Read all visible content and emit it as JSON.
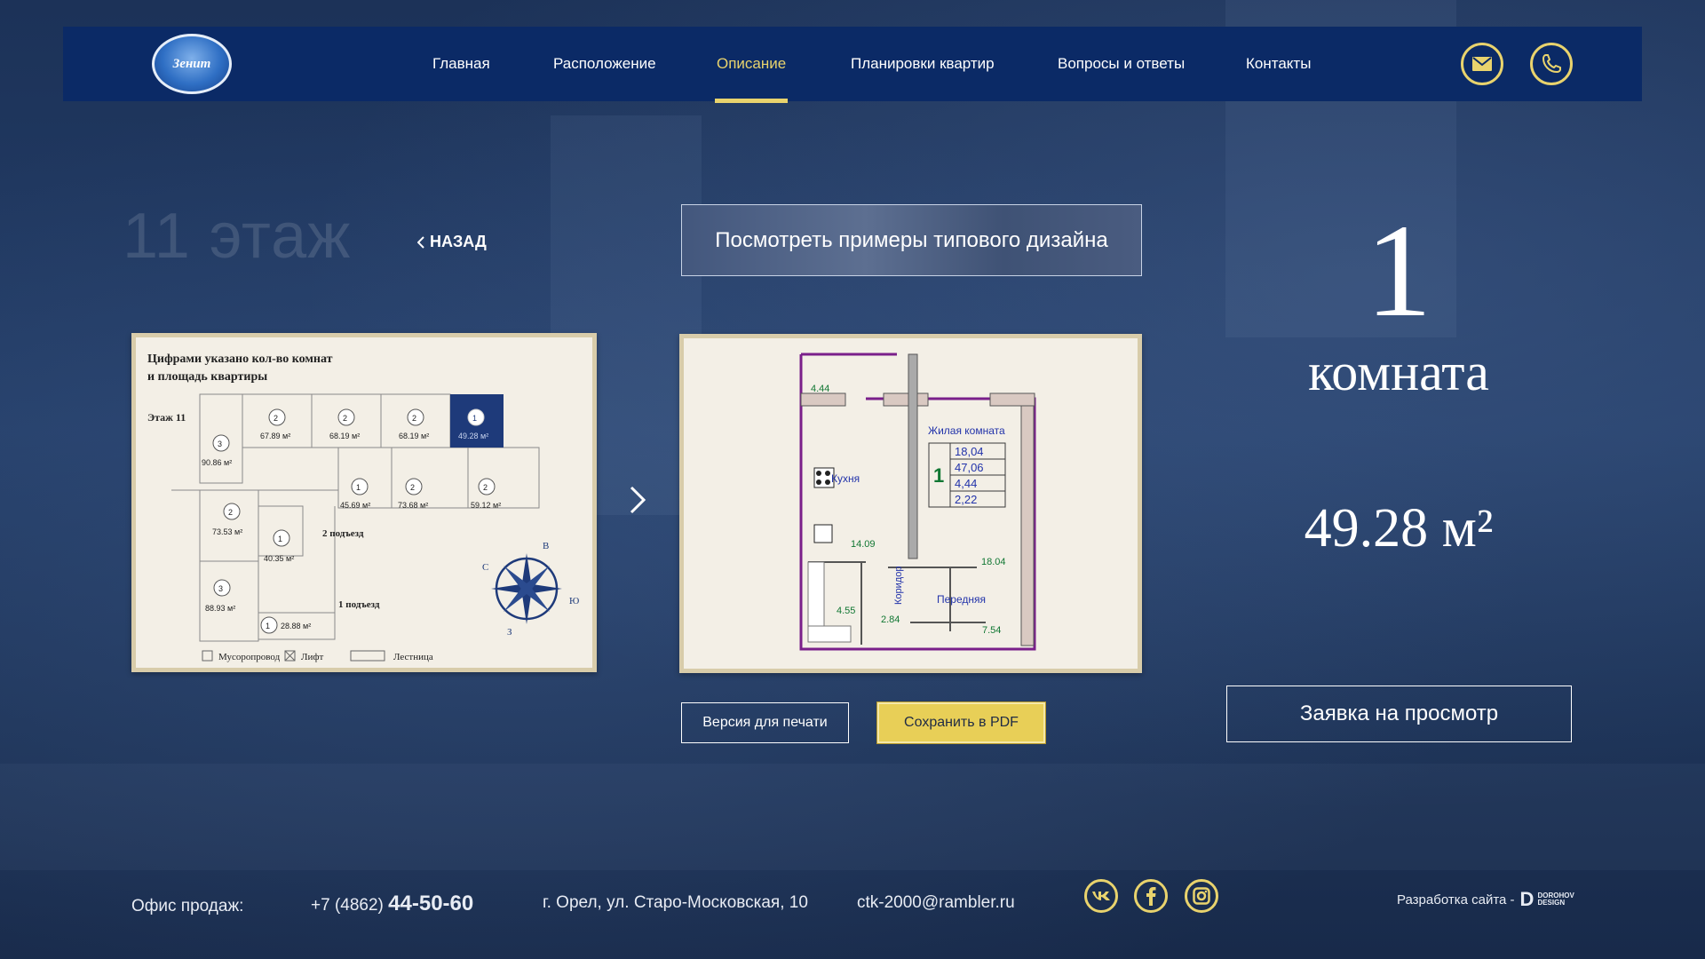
{
  "header": {
    "logo_text": "Зенит",
    "nav": [
      {
        "label": "Главная",
        "active": false
      },
      {
        "label": "Расположение",
        "active": false
      },
      {
        "label": "Описание",
        "active": true
      },
      {
        "label": "Планировки квартир",
        "active": false
      },
      {
        "label": "Вопросы и ответы",
        "active": false
      },
      {
        "label": "Контакты",
        "active": false
      }
    ],
    "icons": [
      "mail-icon",
      "phone-icon"
    ]
  },
  "page": {
    "floor_title": "11 этаж",
    "back_label": "НАЗАД",
    "design_banner": "Посмотреть примеры типового дизайна",
    "print_button": "Версия для печати",
    "pdf_button": "Сохранить в PDF"
  },
  "floor_plan": {
    "caption_line1": "Цифрами указано кол-во комнат",
    "caption_line2": "и площадь квартиры",
    "floor_label": "Этаж 11",
    "apartments": [
      {
        "rooms": "3",
        "area": "90.86 м²"
      },
      {
        "rooms": "2",
        "area": "67.89 м²"
      },
      {
        "rooms": "2",
        "area": "68.19 м²"
      },
      {
        "rooms": "2",
        "area": "68.19 м²"
      },
      {
        "rooms": "1",
        "area": "49.28 м²"
      },
      {
        "rooms": "1",
        "area": "45.69 м²"
      },
      {
        "rooms": "2",
        "area": "73.68 м²"
      },
      {
        "rooms": "2",
        "area": "59.12 м²"
      },
      {
        "rooms": "2",
        "area": "73.53 м²"
      },
      {
        "rooms": "1",
        "area": "40.35 м²"
      },
      {
        "rooms": "3",
        "area": "88.93 м²"
      },
      {
        "rooms": "1",
        "area": "28.88 м²"
      }
    ],
    "entrance2": "2 подъезд",
    "entrance1": "1 подъезд",
    "compass": [
      "С",
      "В",
      "Ю",
      "З"
    ],
    "legend": [
      "Мусоропровод",
      "Лифт",
      "Лестница"
    ]
  },
  "apartment_plan": {
    "living_room_label": "Жилая комната",
    "room_count": "1",
    "areas_table": [
      "18,04",
      "47,06",
      "4,44",
      "2,22"
    ],
    "kitchen": "Кухня",
    "corridor": "Коридор",
    "hall": "Передняя",
    "dims": [
      "4.44",
      "14.09",
      "18.04",
      "4.55",
      "2.84",
      "7.54"
    ]
  },
  "summary": {
    "rooms_number": "1",
    "rooms_word": "комната",
    "area": "49.28 м²",
    "request_button": "Заявка на просмотр"
  },
  "footer": {
    "office_label": "Офис продаж:",
    "phone_prefix": "+7 (4862)",
    "phone_main": "44-50-60",
    "address": "г. Орел, ул. Старо-Московская, 10",
    "email": "ctk-2000@rambler.ru",
    "social": [
      "vk-icon",
      "facebook-icon",
      "instagram-icon"
    ],
    "dev_label": "Разработка сайта -",
    "dev_brand_line1": "DOROHOV",
    "dev_brand_line2": "DESIGN"
  },
  "colors": {
    "accent": "#e9d36d",
    "header_bg": "#0b2a66",
    "background": "#243e68"
  }
}
